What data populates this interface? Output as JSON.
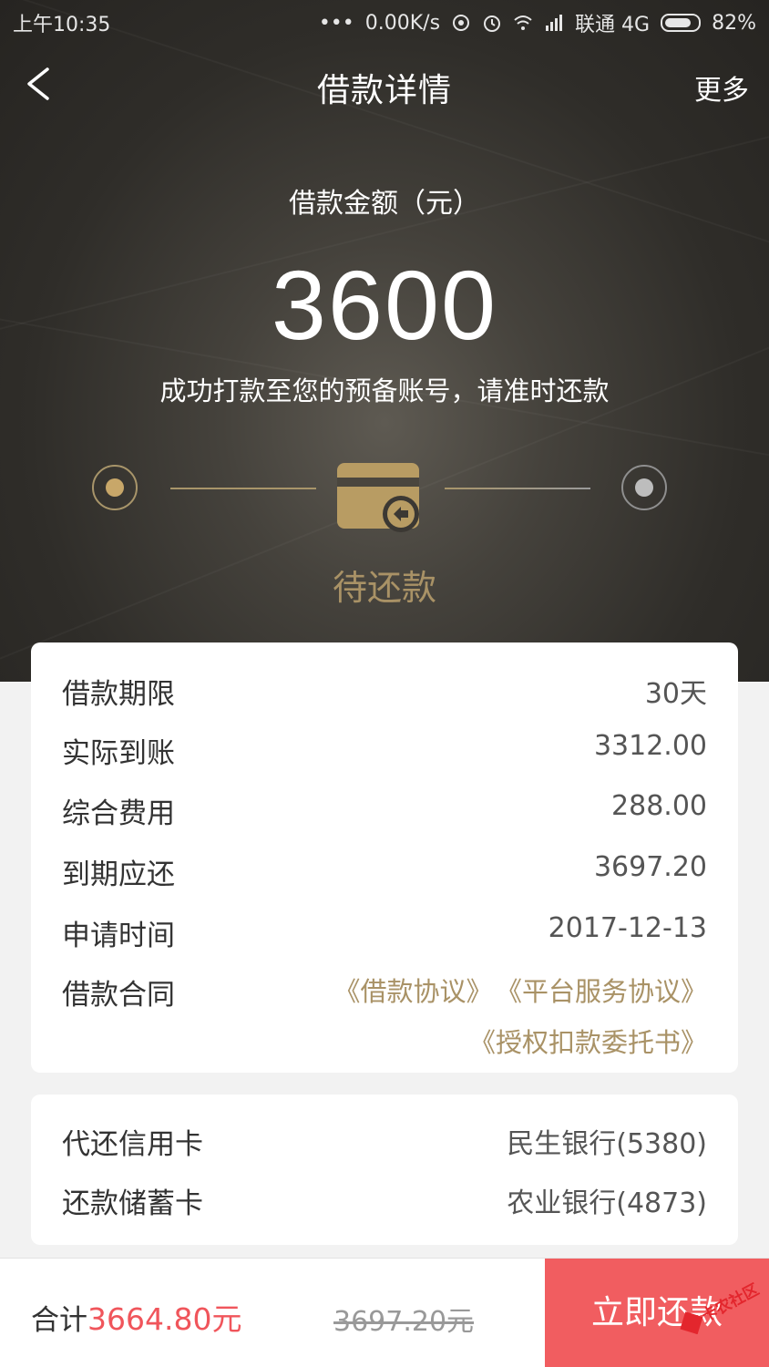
{
  "status_bar": {
    "time": "上午10:35",
    "net_speed": "0.00K/s",
    "carrier": "联通 4G",
    "battery": "82%",
    "battery_level": 0.82
  },
  "nav": {
    "back_icon": "back-arrow-icon",
    "title": "借款详情",
    "more": "更多"
  },
  "hero": {
    "amount_label": "借款金额（元）",
    "amount": "3600",
    "note": "成功打款至您的预备账号，请准时还款",
    "state": "待还款",
    "accent_color": "#a99266"
  },
  "details": [
    {
      "key": "借款期限",
      "value": "30天"
    },
    {
      "key": "实际到账",
      "value": "3312.00"
    },
    {
      "key": "综合费用",
      "value": "288.00"
    },
    {
      "key": "到期应还",
      "value": "3697.20"
    },
    {
      "key": "申请时间",
      "value": "2017-12-13"
    }
  ],
  "contract": {
    "key": "借款合同",
    "links": [
      "《借款协议》",
      "《平台服务协议》",
      "《授权扣款委托书》"
    ]
  },
  "cards": [
    {
      "key": "代还信用卡",
      "value": "民生银行(5380)"
    },
    {
      "key": "还款储蓄卡",
      "value": "农业银行(4873)"
    }
  ],
  "footer": {
    "total_label": "合计",
    "total_value": "3664.80元",
    "original": "3697.20元",
    "pay_button": "立即还款",
    "accent_color": "#f15d60"
  },
  "watermark": "卡农社区"
}
